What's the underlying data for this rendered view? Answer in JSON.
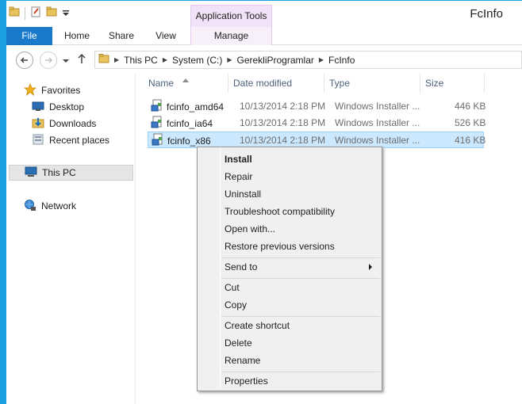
{
  "window": {
    "title": "FcInfo",
    "accent_color": "#1aa1e2"
  },
  "ribbon": {
    "context_header": "Application Tools",
    "tabs": [
      {
        "label": "File"
      },
      {
        "label": "Home"
      },
      {
        "label": "Share"
      },
      {
        "label": "View"
      },
      {
        "label": "Manage"
      }
    ]
  },
  "address": {
    "crumbs": [
      "This PC",
      "System (C:)",
      "GerekliProgramlar",
      "FcInfo"
    ]
  },
  "navpane": {
    "items": [
      {
        "label": "Favorites",
        "icon": "star-icon"
      },
      {
        "label": "Desktop",
        "icon": "desktop-icon"
      },
      {
        "label": "Downloads",
        "icon": "downloads-icon"
      },
      {
        "label": "Recent places",
        "icon": "recent-places-icon"
      },
      {
        "label": "This PC",
        "icon": "computer-icon"
      },
      {
        "label": "Network",
        "icon": "network-icon"
      }
    ]
  },
  "filelist": {
    "columns": [
      "Name",
      "Date modified",
      "Type",
      "Size"
    ],
    "rows": [
      {
        "name": "fcinfo_amd64",
        "date": "10/13/2014 2:18 PM",
        "type": "Windows Installer ...",
        "size": "446 KB"
      },
      {
        "name": "fcinfo_ia64",
        "date": "10/13/2014 2:18 PM",
        "type": "Windows Installer ...",
        "size": "526 KB"
      },
      {
        "name": "fcinfo_x86",
        "date": "10/13/2014 2:18 PM",
        "type": "Windows Installer ...",
        "size": "416 KB"
      }
    ]
  },
  "context_menu": {
    "items": [
      {
        "label": "Install"
      },
      {
        "label": "Repair"
      },
      {
        "label": "Uninstall"
      },
      {
        "label": "Troubleshoot compatibility"
      },
      {
        "label": "Open with..."
      },
      {
        "label": "Restore previous versions"
      },
      {
        "label": "Send to"
      },
      {
        "label": "Cut"
      },
      {
        "label": "Copy"
      },
      {
        "label": "Create shortcut"
      },
      {
        "label": "Delete"
      },
      {
        "label": "Rename"
      },
      {
        "label": "Properties"
      }
    ]
  }
}
